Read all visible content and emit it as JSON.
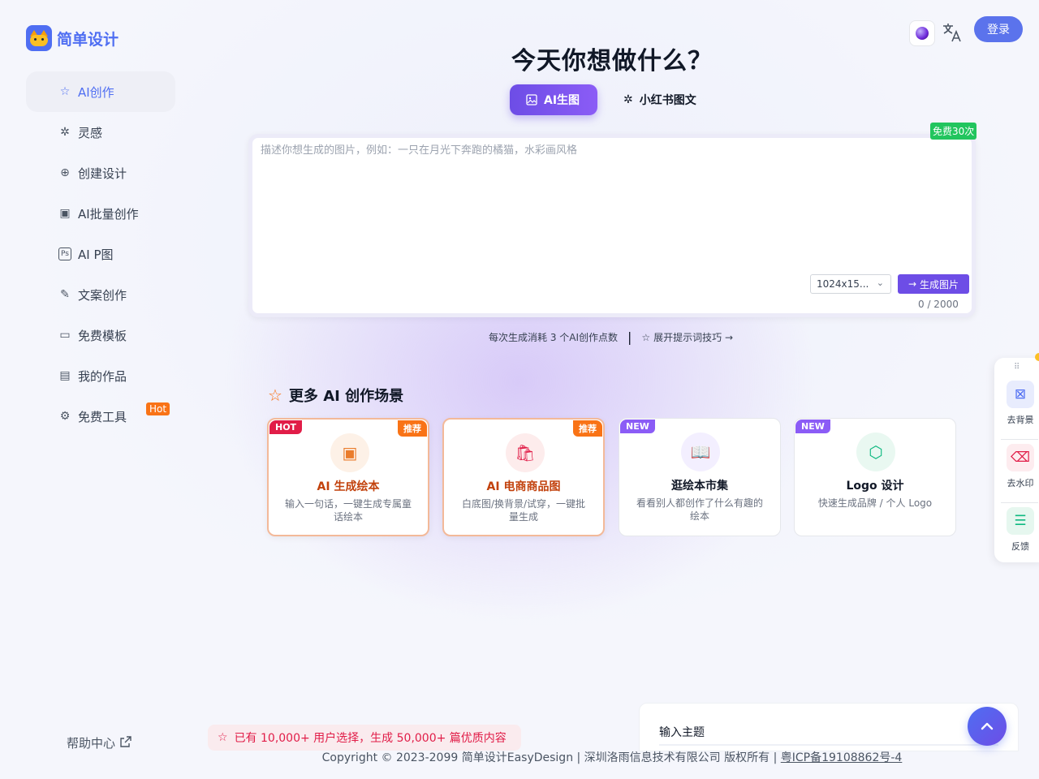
{
  "brand": {
    "name": "简单设计"
  },
  "header": {
    "login_label": "登录",
    "lang_icon": "文A"
  },
  "sidebar": {
    "items": [
      {
        "icon": "☆",
        "label": "AI创作",
        "active": true
      },
      {
        "icon": "✲",
        "label": "灵感"
      },
      {
        "icon": "⊕",
        "label": "创建设计"
      },
      {
        "icon": "▣",
        "label": "AI批量创作"
      },
      {
        "icon": "Ps",
        "label": "AI P图"
      },
      {
        "icon": "✎",
        "label": "文案创作"
      },
      {
        "icon": "▭",
        "label": "免费模板"
      },
      {
        "icon": "▤",
        "label": "我的作品"
      },
      {
        "icon": "⚙",
        "label": "免费工具",
        "badge": "Hot"
      }
    ],
    "help_label": "帮助中心"
  },
  "main": {
    "title": "今天你想做什么？",
    "tabs": [
      {
        "icon": "▣",
        "label": "AI生图",
        "active": true
      },
      {
        "icon": "✲",
        "label": "小红书图文"
      }
    ],
    "prompt": {
      "placeholder": "描述你想生成的图片，例如：一只在月光下奔跑的橘猫，水彩画风格",
      "value": "",
      "free_badge": "免费30次",
      "size_value": "1024x15...",
      "generate_label": "生成图片",
      "char_count": "0 / 2000"
    },
    "hint": {
      "cost_text": "每次生成消耗 3 个AI创作点数",
      "tips_label": "展开提示词技巧 →"
    },
    "scenes": {
      "title": "更多 AI 创作场景",
      "cards": [
        {
          "tag": "HOT",
          "tag_color": "#e11d48",
          "corner": "推荐",
          "icon": "▣",
          "icon_color": "#ea7c2c",
          "icon_bg": "#fdf1e7",
          "title": "AI 生成绘本",
          "title_color": "#c2410c",
          "desc": "输入一句话，一键生成专属童话绘本"
        },
        {
          "tag": "",
          "corner": "推荐",
          "icon": "🛍",
          "icon_color": "#e11d48",
          "icon_bg": "#fdecec",
          "title": "AI 电商商品图",
          "title_color": "#c2410c",
          "desc": "白底图/换背景/试穿，一键批量生成"
        },
        {
          "tag": "NEW",
          "tag_color": "#8b5cf6",
          "corner": "",
          "icon": "📖",
          "icon_color": "#8b5cf6",
          "icon_bg": "#f3efff",
          "title": "逛绘本市集",
          "title_color": "#111827",
          "desc": "看看别人都创作了什么有趣的绘本"
        },
        {
          "tag": "NEW",
          "tag_color": "#8b5cf6",
          "corner": "",
          "icon": "⬡",
          "icon_color": "#10b981",
          "icon_bg": "#e9f8f1",
          "title": "Logo 设计",
          "title_color": "#111827",
          "desc": "快速生成品牌 / 个人 Logo"
        }
      ]
    }
  },
  "float_panel": [
    {
      "icon": "⊠",
      "label": "去背景",
      "color": "#4f6ef2",
      "bg": "#e8ecfd"
    },
    {
      "icon": "⌫",
      "label": "去水印",
      "color": "#e11d48",
      "bg": "#fdecef"
    },
    {
      "icon": "☰",
      "label": "反馈",
      "color": "#10b981",
      "bg": "#e6f7ef"
    }
  ],
  "footer": {
    "stat_text": "已有 10,000+ 用户选择，生成 50,000+ 篇优质内容",
    "topic_label": "输入主题",
    "copyright": "Copyright © 2023-2099 简单设计EasyDesign | 深圳洛雨信息技术有限公司 版权所有 | ",
    "icp": "粤ICP备19108862号-4"
  }
}
